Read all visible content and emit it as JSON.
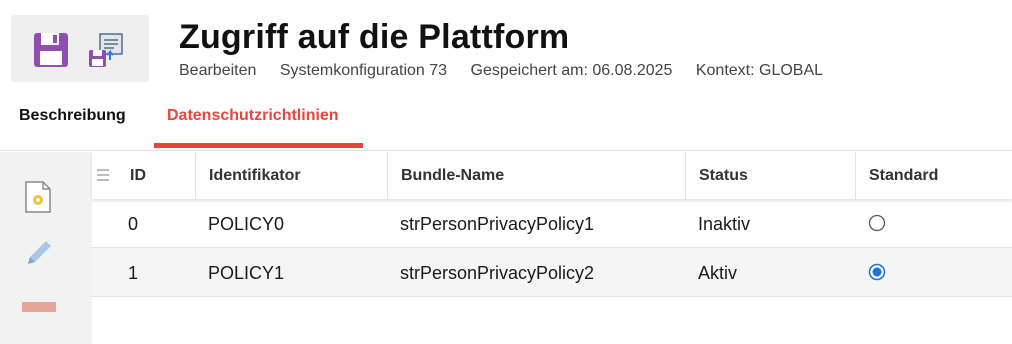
{
  "header": {
    "title": "Zugriff auf die Plattform",
    "meta": {
      "mode": "Bearbeiten",
      "config": "Systemkonfiguration 73",
      "saved": "Gespeichert am: 06.08.2025",
      "context": "Kontext: GLOBAL"
    },
    "toolbar": {
      "save_icon": "floppy-disk-icon",
      "export_icon": "save-export-icon"
    }
  },
  "tabs": [
    {
      "label": "Beschreibung",
      "active": false
    },
    {
      "label": "Datenschutzrichtlinien",
      "active": true
    }
  ],
  "sidebar": {
    "actions": [
      {
        "icon": "new-document-icon"
      },
      {
        "icon": "pencil-icon"
      },
      {
        "icon": "remove-icon"
      }
    ]
  },
  "table": {
    "columns": [
      "ID",
      "Identifikator",
      "Bundle-Name",
      "Status",
      "Standard"
    ],
    "rows": [
      {
        "id": "0",
        "identifier": "POLICY0",
        "bundle": "strPersonPrivacyPolicy1",
        "status": "Inaktiv",
        "standard": false
      },
      {
        "id": "1",
        "identifier": "POLICY1",
        "bundle": "strPersonPrivacyPolicy2",
        "status": "Aktiv",
        "standard": true
      }
    ]
  },
  "colors": {
    "accent": "#e8453c",
    "save_icon": "#8e4fb0",
    "radio_selected": "#1a73d9",
    "remove_icon": "#e8a59a"
  }
}
